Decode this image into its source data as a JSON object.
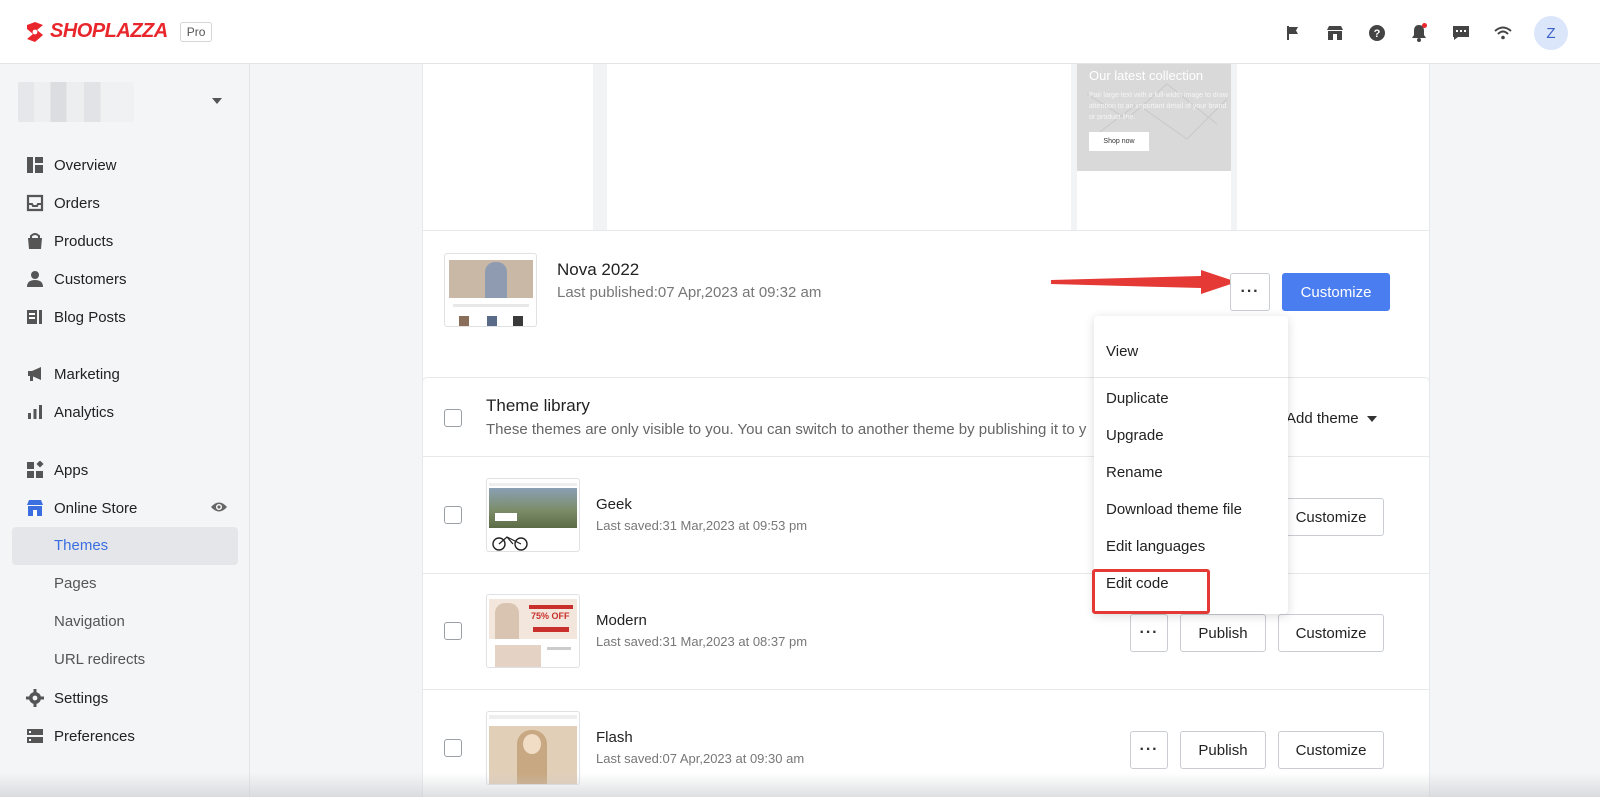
{
  "brand": {
    "name": "SHOPLAZZA",
    "plan_badge": "Pro"
  },
  "header": {
    "icons": [
      "flag-icon",
      "store-icon",
      "help-icon",
      "bell-icon",
      "chat-icon",
      "wifi-icon"
    ],
    "avatar_initial": "Z"
  },
  "sidebar": {
    "items": [
      {
        "label": "Overview",
        "icon": "overview-icon"
      },
      {
        "label": "Orders",
        "icon": "inbox-icon"
      },
      {
        "label": "Products",
        "icon": "bag-icon"
      },
      {
        "label": "Customers",
        "icon": "person-icon"
      },
      {
        "label": "Blog Posts",
        "icon": "blog-icon"
      },
      {
        "label": "Marketing",
        "icon": "megaphone-icon"
      },
      {
        "label": "Analytics",
        "icon": "bar-chart-icon"
      },
      {
        "label": "Apps",
        "icon": "apps-icon"
      },
      {
        "label": "Online Store",
        "icon": "storefront-icon"
      },
      {
        "label": "Settings",
        "icon": "gear-icon"
      },
      {
        "label": "Preferences",
        "icon": "preferences-icon"
      }
    ],
    "online_store_sub": [
      "Themes",
      "Pages",
      "Navigation",
      "URL redirects"
    ],
    "active_sub": "Themes"
  },
  "preview": {
    "collection_title": "Our latest collection",
    "collection_text": "Pair large text with a full-width image to draw attention to an important detail of your brand or product line.",
    "shop_now": "Shop now"
  },
  "current_theme": {
    "name": "Nova 2022",
    "published": "Last published:07 Apr,2023 at 09:32 am",
    "more_label": "···",
    "customize_label": "Customize"
  },
  "dropdown": {
    "items": [
      "View",
      "Duplicate",
      "Upgrade",
      "Rename",
      "Download theme file",
      "Edit languages",
      "Edit code"
    ]
  },
  "library": {
    "title": "Theme library",
    "description": "These themes are only visible to you. You can switch to another theme by publishing it to y",
    "add_theme": "Add theme",
    "themes": [
      {
        "name": "Geek",
        "saved": "Last saved:31 Mar,2023 at 09:53 pm"
      },
      {
        "name": "Modern",
        "saved": "Last saved:31 Mar,2023 at 08:37 pm"
      },
      {
        "name": "Flash",
        "saved": "Last saved:07 Apr,2023 at 09:30 am"
      }
    ],
    "more_label": "···",
    "publish_label": "Publish",
    "customize_label": "Customize"
  },
  "thumb_texts": {
    "modern_banner": "75% OFF"
  },
  "colors": {
    "brand": "#e8262c",
    "primary": "#4a7df0",
    "annotation": "#e53935"
  }
}
